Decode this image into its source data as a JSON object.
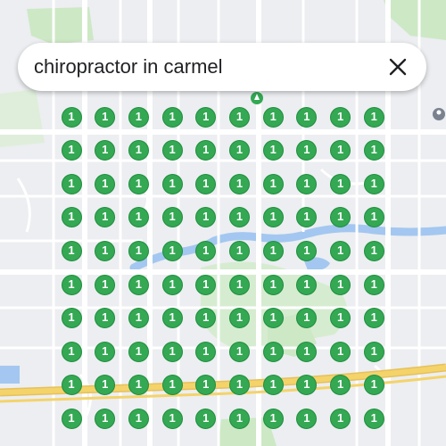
{
  "search": {
    "query": "chiropractor in carmel"
  },
  "icons": {
    "clear": "close-icon",
    "poi_green": "park-poi-icon",
    "poi_gray": "place-poi-icon"
  },
  "colors": {
    "pin_fill": "#34a853",
    "pin_border": "#1e8e3e",
    "water": "#a3c7f0",
    "park": "#cde8c5",
    "highway": "#f4d36b",
    "road": "#ffffff",
    "land": "#eceef1"
  },
  "pin_grid": {
    "rows": 10,
    "cols": 10,
    "labels": [
      [
        "1",
        "1",
        "1",
        "1",
        "1",
        "1",
        "1",
        "1",
        "1",
        "1"
      ],
      [
        "1",
        "1",
        "1",
        "1",
        "1",
        "1",
        "1",
        "1",
        "1",
        "1"
      ],
      [
        "1",
        "1",
        "1",
        "1",
        "1",
        "1",
        "1",
        "1",
        "1",
        "1"
      ],
      [
        "1",
        "1",
        "1",
        "1",
        "1",
        "1",
        "1",
        "1",
        "1",
        "1"
      ],
      [
        "1",
        "1",
        "1",
        "1",
        "1",
        "1",
        "1",
        "1",
        "1",
        "1"
      ],
      [
        "1",
        "1",
        "1",
        "1",
        "1",
        "1",
        "1",
        "1",
        "1",
        "1"
      ],
      [
        "1",
        "1",
        "1",
        "1",
        "1",
        "1",
        "1",
        "1",
        "1",
        "1"
      ],
      [
        "1",
        "1",
        "1",
        "1",
        "1",
        "1",
        "1",
        "1",
        "1",
        "1"
      ],
      [
        "1",
        "1",
        "1",
        "1",
        "1",
        "1",
        "1",
        "1",
        "1",
        "1"
      ],
      [
        "1",
        "1",
        "1",
        "1",
        "1",
        "1",
        "1",
        "1",
        "1",
        "1"
      ]
    ]
  }
}
